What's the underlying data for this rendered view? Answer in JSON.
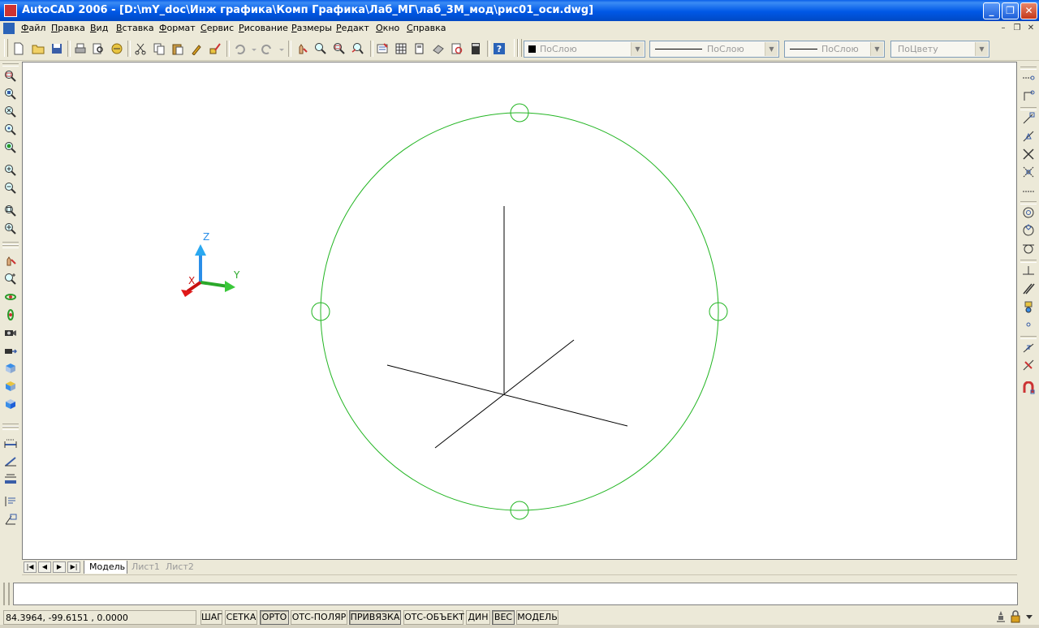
{
  "window": {
    "title": "AutoCAD 2006 - [D:\\mY_doc\\Инж графика\\Комп Графика\\Лаб_МГ\\лаб_3М_мод\\рис01_оси.dwg]",
    "controls": [
      "_",
      "❐",
      "✕"
    ]
  },
  "menu": {
    "items": [
      "Файл",
      "Правка",
      "Вид",
      "Вставка",
      "Формат",
      "Сервис",
      "Рисование",
      "Размеры",
      "Редакт",
      "Окно",
      "Справка"
    ],
    "mdi_controls": [
      "–",
      "❐",
      "✕"
    ]
  },
  "properties": {
    "color": "ПоСлою",
    "linetype": "ПоСлою",
    "lineweight": "ПоСлою",
    "plotstyle": "ПоЦвету"
  },
  "ucs_icon": {
    "z_label": "Z",
    "y_label": "Y",
    "x_label": "X"
  },
  "drawing": {
    "circle_color": "#22b522",
    "axes_color": "#000000"
  },
  "layout_tabs": {
    "nav": [
      "|◀",
      "◀",
      "▶",
      "▶|"
    ],
    "tabs": [
      "Модель",
      "Лист1",
      "Лист2"
    ],
    "active": "Модель"
  },
  "command_line": {
    "text": ""
  },
  "status": {
    "coordinates": "84.3964,  -99.6151 , 0.0000",
    "toggles": [
      {
        "label": "ШАГ",
        "on": false
      },
      {
        "label": "СЕТКА",
        "on": false
      },
      {
        "label": "ОРТО",
        "on": true
      },
      {
        "label": "ОТС-ПОЛЯР",
        "on": false
      },
      {
        "label": "ПРИВЯЗКА",
        "on": true
      },
      {
        "label": "ОТС-ОБЪЕКТ",
        "on": false
      },
      {
        "label": "ДИН",
        "on": false
      },
      {
        "label": "ВЕС",
        "on": true
      },
      {
        "label": "МОДЕЛЬ",
        "on": false
      }
    ]
  },
  "icons": {
    "standard_toolbar": [
      "new-icon",
      "open-icon",
      "save-icon",
      "plot-icon",
      "plot-preview-icon",
      "publish-icon",
      "cut-icon",
      "copy-icon",
      "paste-icon",
      "match-properties-icon",
      "block-editor-icon",
      "undo-icon",
      "redo-icon",
      "pan-icon",
      "zoom-realtime-icon",
      "zoom-window-icon",
      "zoom-previous-icon",
      "properties-icon",
      "design-center-icon",
      "tool-palettes-icon",
      "sheet-set-icon",
      "markup-icon",
      "calculator-icon",
      "help-icon"
    ],
    "zoom_toolbar": [
      "zoom-window-icon",
      "zoom-dynamic-icon",
      "zoom-scale-icon",
      "zoom-center-icon",
      "zoom-object-icon",
      "zoom-in-icon",
      "zoom-out-icon",
      "zoom-all-icon",
      "zoom-extents-icon"
    ],
    "view_toolbar": [
      "pan-icon",
      "zoom-realtime-icon",
      "orbit-icon",
      "free-orbit-icon",
      "camera-icon",
      "walk-icon",
      "top-view-icon",
      "front-view-icon",
      "iso-view-icon"
    ],
    "dimension_toolbar": [
      "linear-dim-icon",
      "aligned-dim-icon",
      "baseline-dim-icon",
      "leader-icon",
      "tolerance-icon"
    ],
    "snap_toolbar": [
      "temp-track-icon",
      "snap-from-icon",
      "snap-endpoint-icon",
      "snap-midpoint-icon",
      "snap-intersection-icon",
      "snap-apparent-icon",
      "snap-extension-icon",
      "snap-center-icon",
      "snap-quadrant-icon",
      "snap-tangent-icon",
      "snap-perpendicular-icon",
      "snap-parallel-icon",
      "snap-insert-icon",
      "snap-node-icon",
      "snap-nearest-icon",
      "snap-none-icon",
      "osnap-settings-icon"
    ]
  }
}
